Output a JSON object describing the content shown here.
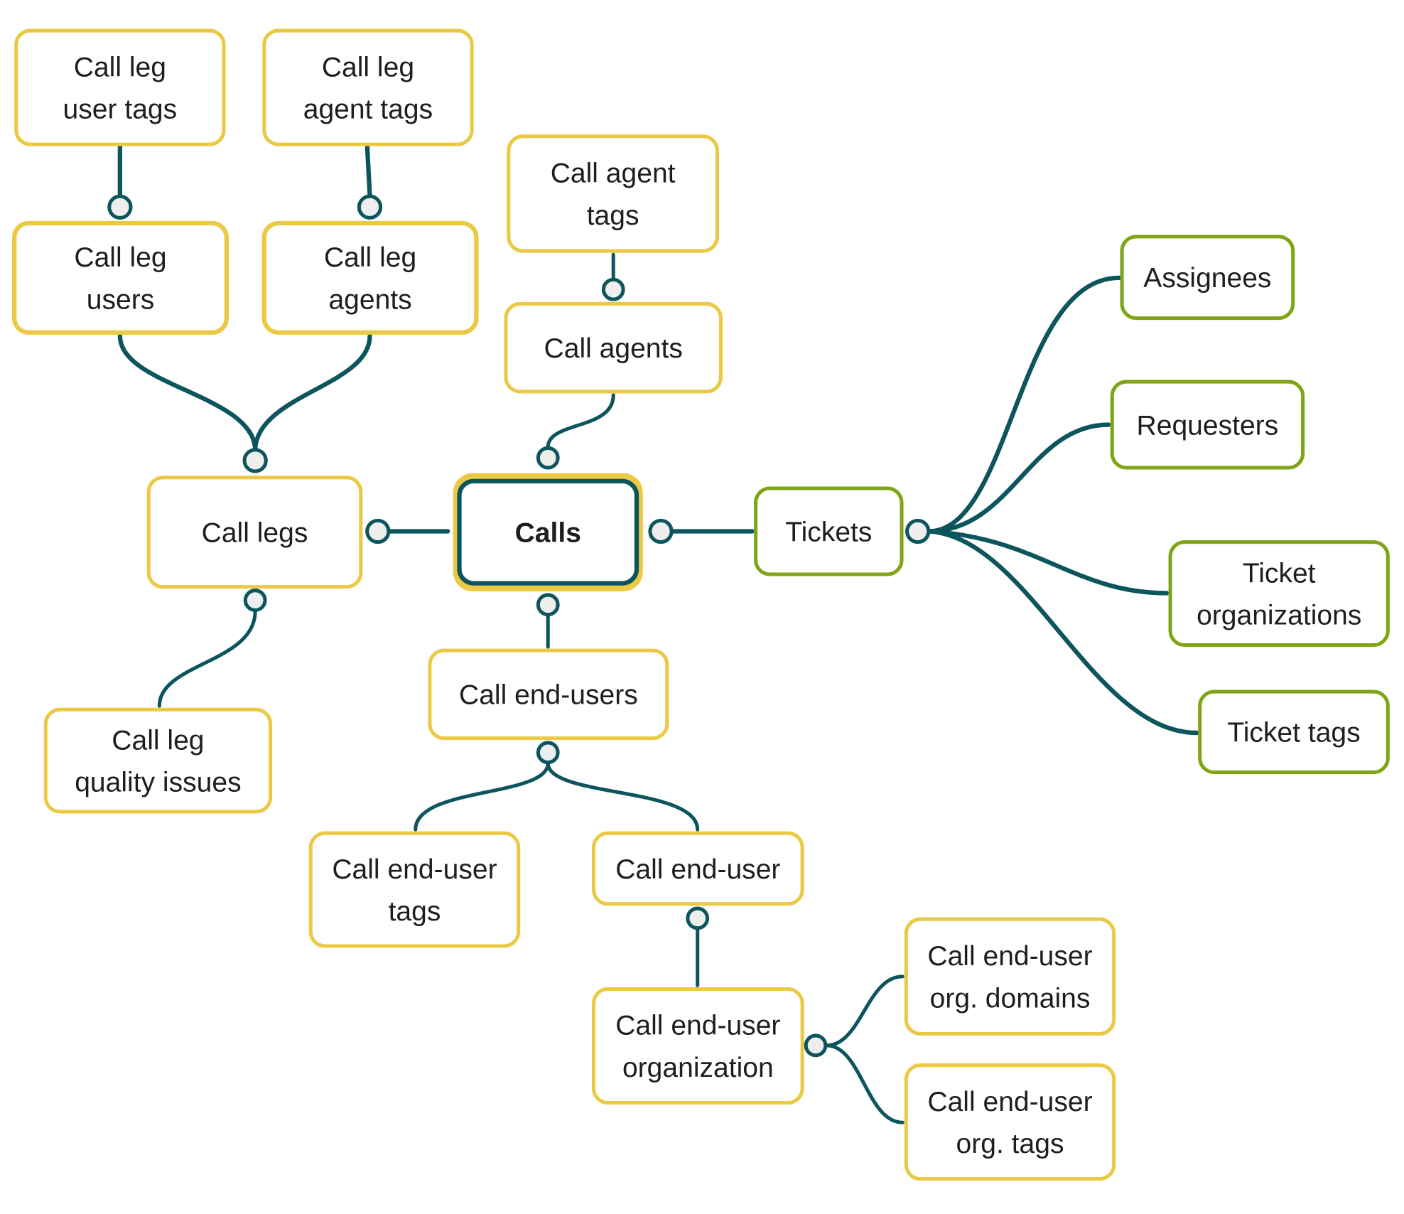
{
  "colors": {
    "entity_border": "#EBC944",
    "related_border": "#7FA517",
    "connector": "#0D555C",
    "knob_fill": "#EEEEEE",
    "center_inner_border": "#0D555C",
    "text": "#1E1E1E"
  },
  "nodes": [
    {
      "id": "calls",
      "lines": [
        "Calls"
      ]
    },
    {
      "id": "call-leg-user-tags",
      "lines": [
        "Call leg",
        "user tags"
      ]
    },
    {
      "id": "call-leg-agent-tags",
      "lines": [
        "Call leg",
        "agent tags"
      ]
    },
    {
      "id": "call-leg-users",
      "lines": [
        "Call leg",
        "users"
      ]
    },
    {
      "id": "call-leg-agents",
      "lines": [
        "Call leg",
        "agents"
      ]
    },
    {
      "id": "call-agent-tags",
      "lines": [
        "Call agent",
        "tags"
      ]
    },
    {
      "id": "call-agents",
      "lines": [
        "Call agents"
      ]
    },
    {
      "id": "call-legs",
      "lines": [
        "Call legs"
      ]
    },
    {
      "id": "call-leg-quality-issues",
      "lines": [
        "Call leg",
        "quality issues"
      ]
    },
    {
      "id": "call-end-users",
      "lines": [
        "Call end-users"
      ]
    },
    {
      "id": "call-end-user-tags",
      "lines": [
        "Call end-user",
        "tags"
      ]
    },
    {
      "id": "call-end-user",
      "lines": [
        "Call end-user"
      ]
    },
    {
      "id": "call-end-user-organization",
      "lines": [
        "Call end-user",
        "organization"
      ]
    },
    {
      "id": "call-end-user-org-domains",
      "lines": [
        "Call end-user",
        "org. domains"
      ]
    },
    {
      "id": "call-end-user-org-tags",
      "lines": [
        "Call end-user",
        "org. tags"
      ]
    },
    {
      "id": "tickets",
      "lines": [
        "Tickets"
      ]
    },
    {
      "id": "assignees",
      "lines": [
        "Assignees"
      ]
    },
    {
      "id": "requesters",
      "lines": [
        "Requesters"
      ]
    },
    {
      "id": "ticket-organizations",
      "lines": [
        "Ticket",
        "organizations"
      ]
    },
    {
      "id": "ticket-tags",
      "lines": [
        "Ticket tags"
      ]
    }
  ]
}
